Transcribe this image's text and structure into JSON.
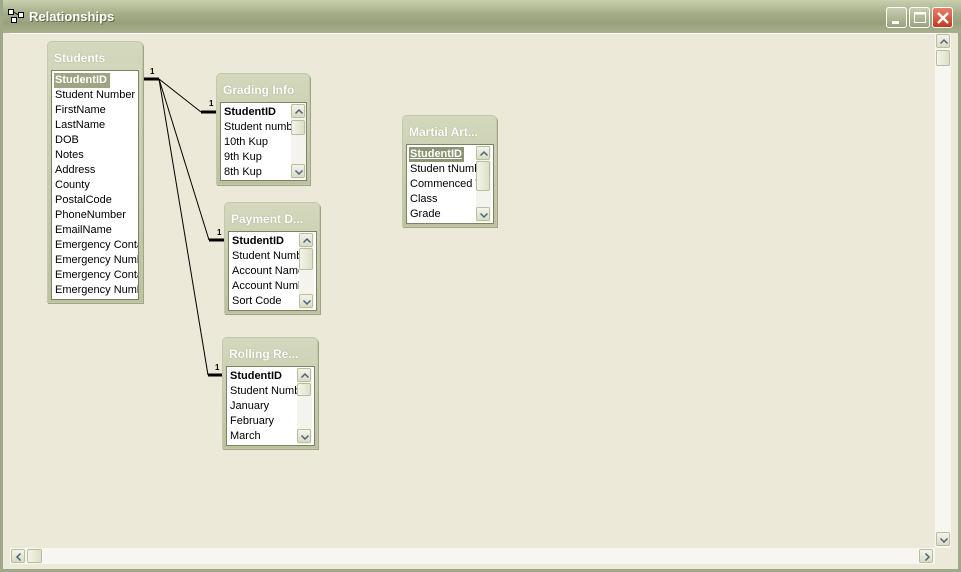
{
  "window": {
    "title": "Relationships"
  },
  "icons": {
    "app": "relationships-icon",
    "minimize": "minimize-icon",
    "maximize": "maximize-icon",
    "close": "close-icon"
  },
  "tables": {
    "students": {
      "title": "Students",
      "fields": [
        "StudentID",
        "Student Number",
        "FirstName",
        "LastName",
        "DOB",
        "Notes",
        "Address",
        "County",
        "PostalCode",
        "PhoneNumber",
        "EmailName",
        "Emergency Conta",
        "Emergency Numb",
        "Emergency Conta",
        "Emergency Numb"
      ]
    },
    "grading": {
      "title": "Grading Info",
      "fields": [
        "StudentID",
        "Student numb",
        "10th Kup",
        "9th Kup",
        "8th Kup"
      ]
    },
    "payment": {
      "title": "Payment D...",
      "fields": [
        "StudentID",
        "Student Numb",
        "Account Name",
        "Account Numb",
        "Sort Code"
      ]
    },
    "rolling": {
      "title": "Rolling Re...",
      "fields": [
        "StudentID",
        "Student Numb",
        "January",
        "February",
        "March"
      ]
    },
    "martial": {
      "title": "Martial Art...",
      "fields": [
        "StudentID",
        "Studen tNumb",
        "Commenced T",
        "Class",
        "Grade"
      ]
    }
  },
  "relationships": {
    "one_label": "1"
  }
}
